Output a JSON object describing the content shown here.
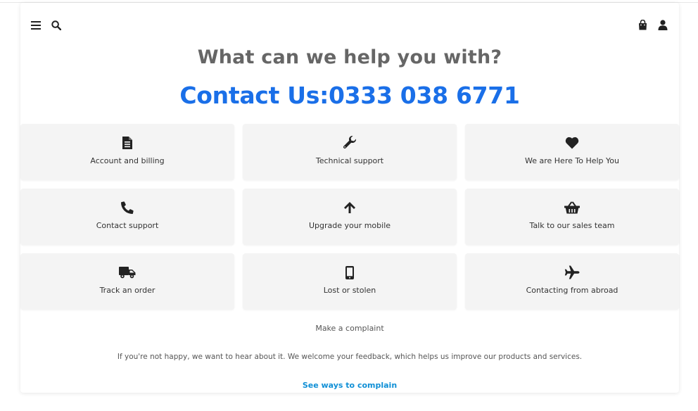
{
  "header": {
    "menu_icon": "hamburger-menu-icon",
    "search_icon": "search-icon",
    "bag_icon": "shopping-bag-icon",
    "account_icon": "user-icon"
  },
  "main": {
    "heading": "What can we help you with?",
    "contact_line": "Contact Us:0333 038 6771",
    "accent_color": "#1a6fe8",
    "tiles": [
      {
        "label": "Account and billing",
        "icon": "document-icon"
      },
      {
        "label": "Technical support",
        "icon": "wrench-icon"
      },
      {
        "label": "We are Here To Help You",
        "icon": "heart-icon"
      },
      {
        "label": "Contact support",
        "icon": "phone-icon"
      },
      {
        "label": "Upgrade your mobile",
        "icon": "arrow-up-icon"
      },
      {
        "label": "Talk to our sales team",
        "icon": "basket-icon"
      },
      {
        "label": "Track an order",
        "icon": "truck-icon"
      },
      {
        "label": "Lost or stolen",
        "icon": "mobile-phone-icon"
      },
      {
        "label": "Contacting from abroad",
        "icon": "plane-icon"
      }
    ]
  },
  "complaint": {
    "title": "Make a complaint",
    "text": "If you're not happy, we want to hear about it. We welcome your feedback, which helps us improve our products and services.",
    "link": "See ways to complain",
    "link_color": "#0f8fd6"
  }
}
